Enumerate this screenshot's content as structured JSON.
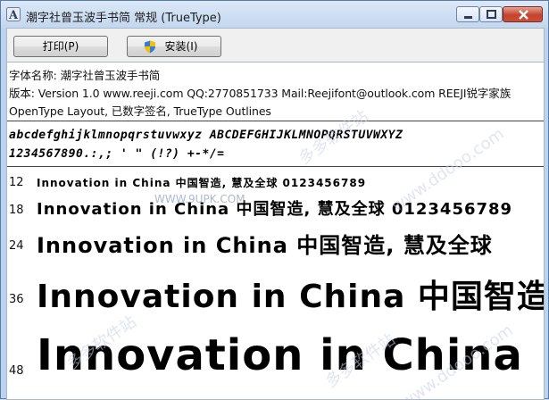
{
  "window": {
    "title": "潮字社曾玉波手书简 常规 (TrueType)"
  },
  "toolbar": {
    "print_label": "打印(P)",
    "install_label": "安装(I)"
  },
  "info": {
    "font_name": "字体名称: 潮字社曾玉波手书简",
    "version": "版本: Version 1.0  www.reeji.com QQ:2770851733 Mail:Reejifont@outlook.com REEJI锐字家族",
    "opentype": "OpenType Layout, 已数字签名, TrueType Outlines"
  },
  "charset": {
    "line1": "abcdefghijklmnopqrstuvwxyz ABCDEFGHIJKLMNOPQRSTUVWXYZ",
    "line2": "1234567890.:,; ' \" (!?) +-*/="
  },
  "samples": [
    {
      "size": "12",
      "text": "Innovation in China 中国智造, 慧及全球 0123456789"
    },
    {
      "size": "18",
      "text": "Innovation in China 中国智造, 慧及全球 0123456789"
    },
    {
      "size": "24",
      "text": "Innovation in China 中国智造, 慧及全球"
    },
    {
      "size": "36",
      "text": "Innovation in China 中国智造"
    },
    {
      "size": "48",
      "text": "Innovation in China"
    }
  ],
  "watermarks": [
    "WWW.9UPK.COM",
    "多多软件站",
    "www.ddooo.com",
    "多多软件站",
    "多多软件站",
    "www.ddooo.com"
  ]
}
